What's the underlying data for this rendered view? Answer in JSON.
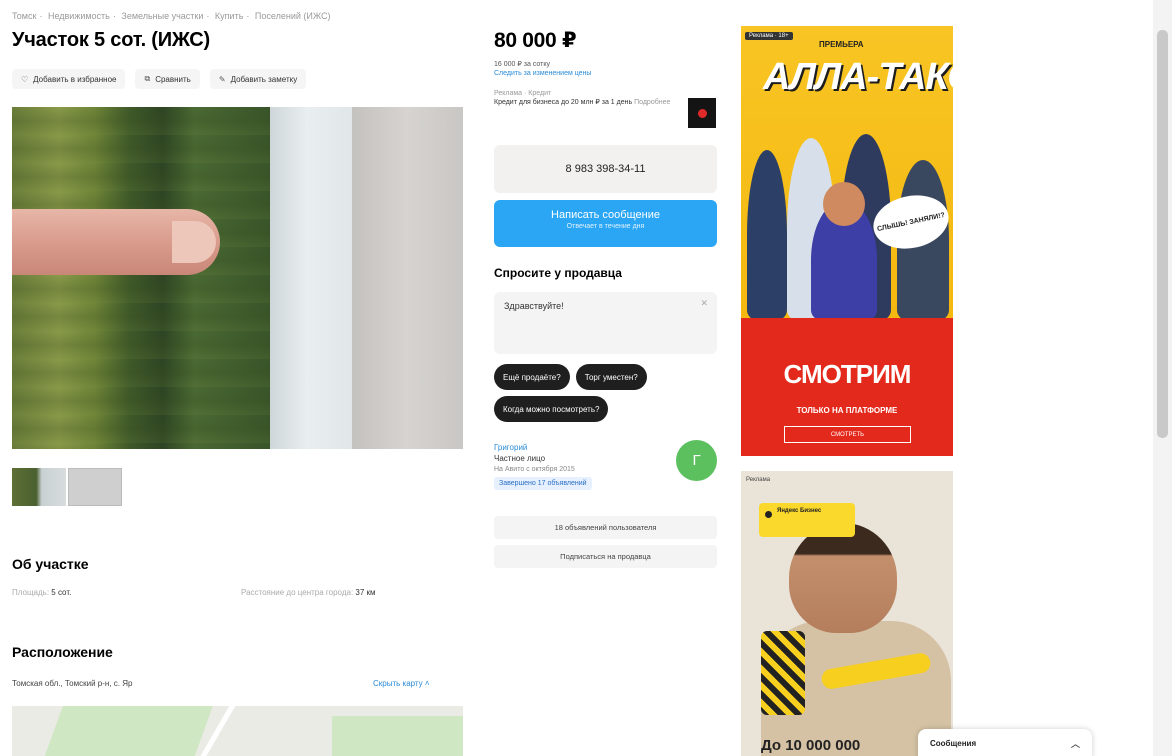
{
  "breadcrumb": [
    "Томск",
    "Недвижимость",
    "Земельные участки",
    "Купить",
    "Поселений (ИЖС)"
  ],
  "title": "Участок 5 сот. (ИЖС)",
  "actions": {
    "favorite": "Добавить в избранное",
    "compare": "Сравнить",
    "note": "Добавить заметку"
  },
  "about": {
    "heading": "Об участке",
    "area_label": "Площадь:",
    "area_value": "5 сот.",
    "distance_label": "Расстояние до центра города:",
    "distance_value": "37 км"
  },
  "location": {
    "heading": "Расположение",
    "address": "Томская обл., Томский р-н, с. Яр",
    "map_link": "Скрыть карту"
  },
  "price": {
    "value": "80 000 ₽",
    "per_unit": "16 000 ₽ за сотку",
    "history_link": "Следить за изменением цены"
  },
  "credit": {
    "tag": "Реклама · Кредит",
    "text": "Кредит для бизнеса до 20 млн ₽ за 1 день",
    "link": "Подробнее"
  },
  "phone": "8 983 398-34-11",
  "message_button": {
    "label": "Написать сообщение",
    "sub": "Отвечает в течение дня"
  },
  "ask": {
    "heading": "Спросите у продавца",
    "placeholder": "Здравствуйте!",
    "chips": [
      "Ещё продаёте?",
      "Торг уместен?",
      "Когда можно посмотреть?"
    ]
  },
  "seller": {
    "name": "Григорий",
    "type": "Частное лицо",
    "since": "На Авито с октября 2015",
    "badge": "Завершено 17 объявлений",
    "avatar_letter": "Г",
    "all_listings": "18 объявлений пользователя",
    "subscribe": "Подписаться на продавца"
  },
  "ads": {
    "ad1": {
      "tag": "Реклама · 18+",
      "premiere": "ПРЕМЬЕРА",
      "show": "АЛЛА-ТАКСИ",
      "bubble": "СЛЫШЬ! ЗАНЯЛИ!?",
      "watch": "СМОТРИМ",
      "only": "ТОЛЬКО НА ПЛАТФОРМЕ",
      "button": "СМОТРЕТЬ"
    },
    "ad2": {
      "header": "Реклама",
      "card": "Яндекс Бизнес",
      "promo": "До 10 000 000"
    }
  },
  "chat": {
    "label": "Сообщения",
    "chevron_icon": "chevron-up-icon"
  },
  "colors": {
    "accent": "#2aa6f5",
    "link": "#2a8bd8",
    "avatar": "#5cc05f"
  }
}
